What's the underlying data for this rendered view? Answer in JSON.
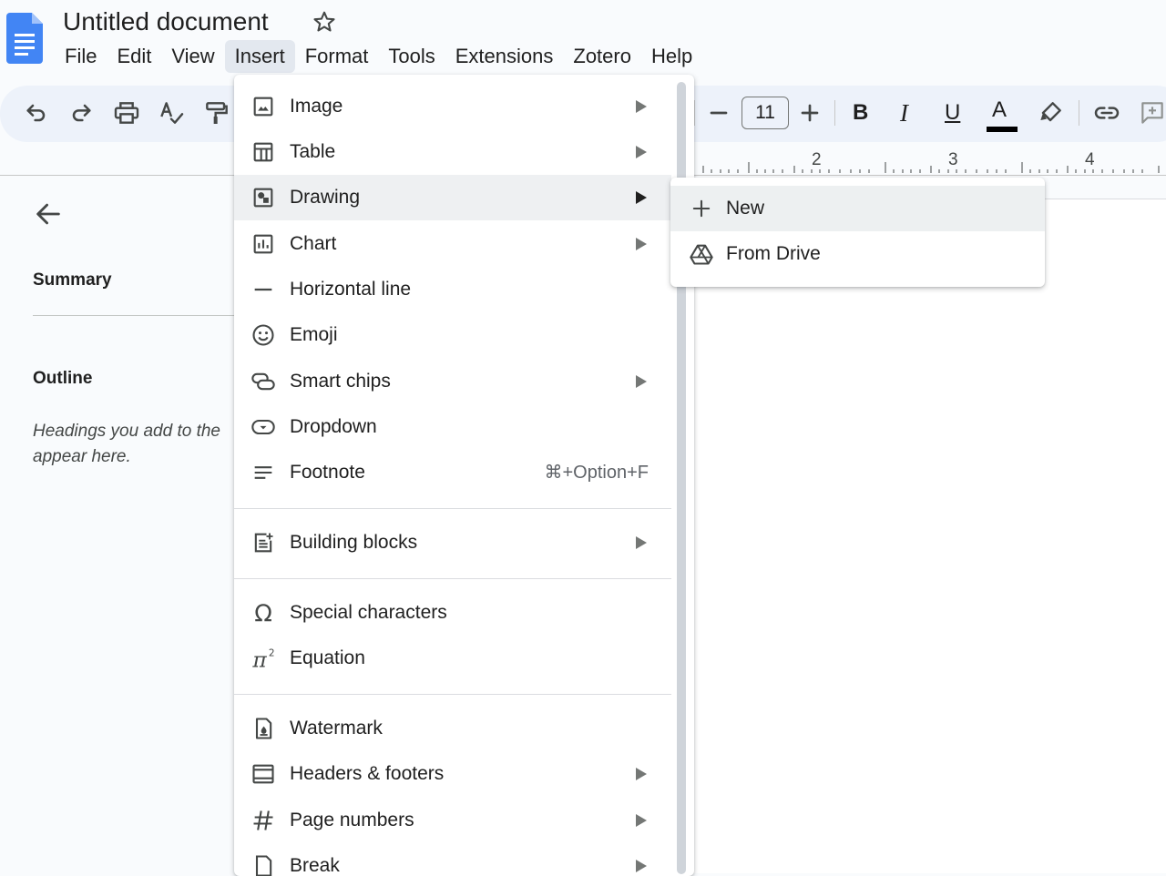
{
  "header": {
    "doc_title": "Untitled document",
    "menu": [
      "File",
      "Edit",
      "View",
      "Insert",
      "Format",
      "Tools",
      "Extensions",
      "Zotero",
      "Help"
    ],
    "active_menu": "Insert"
  },
  "toolbar": {
    "font_size": "11",
    "bold_label": "B",
    "italic_label": "I",
    "underline_label": "U",
    "text_color_label": "A",
    "text_color": "#000000"
  },
  "ruler": {
    "numbers": [
      "2",
      "3",
      "4"
    ]
  },
  "sidebar": {
    "summary_heading": "Summary",
    "outline_heading": "Outline",
    "outline_hint_line1": "Headings you add to the",
    "outline_hint_line2": "appear here."
  },
  "insert_menu": {
    "items": [
      {
        "label": "Image",
        "icon": "image-icon",
        "submenu": true
      },
      {
        "label": "Table",
        "icon": "table-icon",
        "submenu": true
      },
      {
        "label": "Drawing",
        "icon": "drawing-icon",
        "submenu": true,
        "highlighted": true
      },
      {
        "label": "Chart",
        "icon": "chart-icon",
        "submenu": true
      },
      {
        "label": "Horizontal line",
        "icon": "horizontal-line-icon",
        "submenu": false
      },
      {
        "label": "Emoji",
        "icon": "emoji-icon",
        "submenu": false
      },
      {
        "label": "Smart chips",
        "icon": "smart-chips-icon",
        "submenu": true
      },
      {
        "label": "Dropdown",
        "icon": "dropdown-icon",
        "submenu": false
      },
      {
        "label": "Footnote",
        "icon": "footnote-icon",
        "submenu": false,
        "shortcut": "⌘+Option+F"
      },
      {
        "label": "Building blocks",
        "icon": "building-blocks-icon",
        "submenu": true
      },
      {
        "label": "Special characters",
        "icon": "omega-icon",
        "submenu": false
      },
      {
        "label": "Equation",
        "icon": "pi-icon",
        "submenu": false
      },
      {
        "label": "Watermark",
        "icon": "watermark-icon",
        "submenu": false
      },
      {
        "label": "Headers & footers",
        "icon": "headers-footers-icon",
        "submenu": true
      },
      {
        "label": "Page numbers",
        "icon": "hash-icon",
        "submenu": true
      },
      {
        "label": "Break",
        "icon": "break-icon",
        "submenu": true
      }
    ]
  },
  "drawing_submenu": {
    "items": [
      {
        "label": "New",
        "icon": "plus-icon",
        "highlighted": true
      },
      {
        "label": "From Drive",
        "icon": "drive-icon",
        "highlighted": false
      }
    ]
  },
  "colors": {
    "accent": "#1a73e8",
    "doc_logo": "#4285f4",
    "toolbar_bg": "#edf2fa",
    "menu_highlight": "#eef0f2"
  }
}
